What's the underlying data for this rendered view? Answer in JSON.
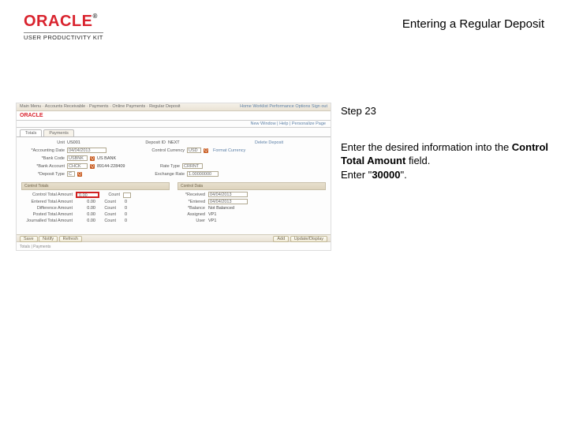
{
  "header": {
    "brand": "ORACLE",
    "brand_sub": "USER PRODUCTIVITY KIT",
    "title": "Entering a Regular Deposit"
  },
  "step": {
    "label": "Step 23",
    "line1_a": "Enter the desired information into the ",
    "line1_field": "Control Total Amount",
    "line1_b": " field.",
    "line2_a": "Enter \"",
    "line2_val": "30000",
    "line2_b": "\"."
  },
  "ss": {
    "topbar_left": "Main Menu · Accounts Receivable · Payments · Online Payments · Regular Deposit",
    "topbar_right_home": "Home",
    "topbar_right_wl": "Worklist",
    "topbar_right_perf": "Performance Options",
    "topbar_right_signout": "Sign out",
    "oracle": "ORACLE",
    "sub_links": "New Window | Help | Personalize Page",
    "tab1": "Totals",
    "tab2": "Payments",
    "unit_label": "Unit",
    "unit_val": "US001",
    "deposit_label": "Deposit ID",
    "deposit_val": "NEXT",
    "acct_label": "*Accounting Date",
    "acct_val": "04/04/2013",
    "bank_label": "*Bank Code",
    "bank_val": "USBNK",
    "bank_name": "US BANK",
    "bankacct_label": "*Bank Account",
    "bankacct_val": "CHCK",
    "bankacct_num": "89144-228409",
    "deptype_label": "*Deposit Type",
    "deptype_val": "C",
    "control_label": "Control Currency",
    "control_val": "USD",
    "format_label": "Format Currency",
    "rate_label": "Rate Type",
    "rate_val": "CRRNT",
    "exch_label": "Exchange Rate",
    "exch_val": "1.00000000",
    "balance_label": "*Balance",
    "balance_val": "Not Balanced",
    "section1": "Control Totals",
    "section2": "Control Data",
    "ctrl_amt_label": "Control Total Amount",
    "ctrl_amt_val": "0.00",
    "ctrl_cnt_label": "Count",
    "entered_label": "Entered Total Amount",
    "entered_val": "0.00",
    "diff_label": "Difference Amount",
    "diff_val": "0.00",
    "posted_label": "Posted Total Amount",
    "posted_val": "0.00",
    "journal_label": "Journalled Total Amount",
    "journal_val": "0.00",
    "cnt_val": "0",
    "received_label": "*Received",
    "received_val": "04/04/2013",
    "entered2_label": "*Entered",
    "entered2_val": "04/04/2013",
    "assigned_label": "Assigned",
    "assigned_val": "VP1",
    "user_label": "User",
    "user_val": "VP1",
    "save_btn": "Save",
    "notify_btn": "Notify",
    "refresh_btn": "Refresh",
    "add_btn": "Add",
    "update_btn": "Update/Display",
    "footer_links": "Totals | Payments"
  }
}
